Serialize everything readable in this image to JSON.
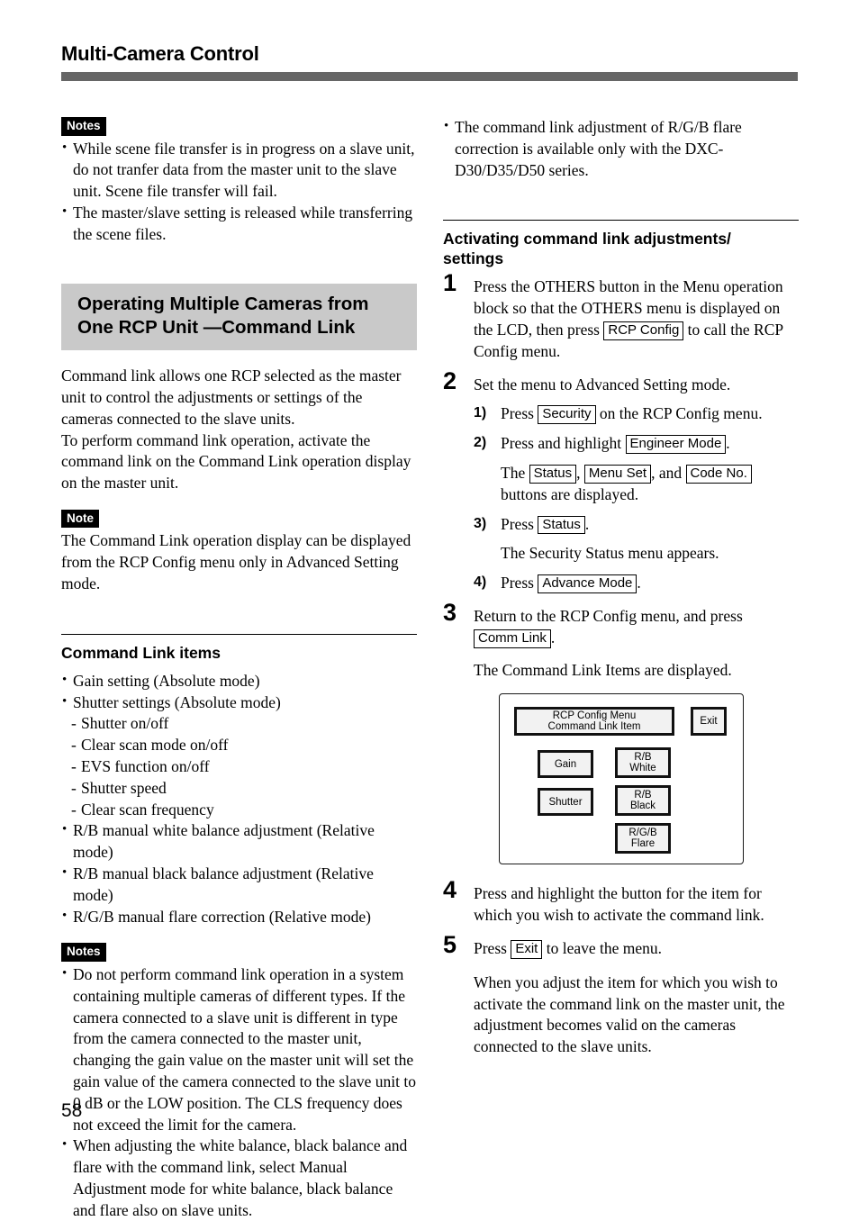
{
  "header": {
    "title": "Multi-Camera Control",
    "rule_color": "#666666"
  },
  "page_number": "58",
  "left_column": {
    "notes_top": {
      "badge": "Notes",
      "items": [
        "While scene file transfer is in progress on a slave unit, do not tranfer data from the master unit to the slave unit.  Scene file transfer will fail.",
        "The master/slave setting is released while transferring the scene files."
      ]
    },
    "section_heading": {
      "line1": "Operating Multiple Cameras from",
      "line2": "One RCP Unit —Command Link",
      "background": "#c9c9c9"
    },
    "intro_paragraph_1": "Command link allows one RCP selected as the master unit to control the adjustments or settings of the cameras connected to the slave units.",
    "intro_paragraph_2": "To perform command link operation, activate the command link on the Command Link operation display on the master unit.",
    "note_single": {
      "badge": "Note",
      "text": "The Command Link operation display can be displayed from the RCP Config menu only in Advanced Setting mode."
    },
    "command_link_items": {
      "heading": "Command Link items",
      "bullets": [
        "Gain setting (Absolute mode)",
        "Shutter settings (Absolute mode)"
      ],
      "sub_dashes": [
        "Shutter on/off",
        "Clear scan mode on/off",
        "EVS function on/off",
        "Shutter speed",
        "Clear scan frequency"
      ],
      "bullets_after": [
        "R/B manual white balance adjustment (Relative mode)",
        "R/B manual black balance adjustment (Relative mode)",
        "R/G/B manual flare correction (Relative mode)"
      ]
    },
    "notes_bottom": {
      "badge": "Notes",
      "items": [
        "Do not perform command link operation in a system containing multiple cameras of different types.  If the camera connected to a slave unit is different in type from the camera connected to the master unit, changing the gain value on the master unit will set the gain value of the camera connected to the slave unit to 0 dB or the LOW position.  The CLS frequency does not exceed the limit for the camera.",
        "When adjusting the white balance, black balance and flare with the command link, select Manual Adjustment mode for white balance, black balance and flare also on slave units."
      ]
    }
  },
  "right_column": {
    "top_bullet": "The command link adjustment of R/G/B flare correction is available only with the DXC-D30/D35/D50 series.",
    "section_heading": {
      "line1": "Activating command link adjustments/",
      "line2": "settings"
    },
    "steps": {
      "step1": {
        "number": "1",
        "text_before": "Press the OTHERS button in the Menu operation block so that the OTHERS menu is displayed on the LCD, then press",
        "key": "RCP Config",
        "text_after": "to call the RCP Config menu."
      },
      "step2": {
        "number": "2",
        "text": "Set the menu to Advanced Setting mode.",
        "sub1": {
          "number": "1)",
          "text_before": "Press",
          "key": "Security",
          "text_after": "on the RCP Config menu."
        },
        "sub2": {
          "number": "2)",
          "text_before": "Press and highlight",
          "key": "Engineer Mode",
          "text_after": "."
        },
        "sub2_note": {
          "lead": "The",
          "key1": "Status",
          "sep1": ",",
          "key2": "Menu Set",
          "sep2": ", and",
          "key3": "Code No.",
          "tail": "buttons are displayed."
        },
        "sub3": {
          "number": "3)",
          "text_before": "Press",
          "key": "Status",
          "text_after": "."
        },
        "sub3_note": "The Security Status menu appears.",
        "sub4": {
          "number": "4)",
          "text_before": "Press",
          "key": "Advance Mode",
          "text_after": "."
        }
      },
      "step3": {
        "number": "3",
        "text_before": "Return to  the RCP Config menu, and press",
        "key": "Comm Link",
        "text_after": ".",
        "result": "The Command Link Items are displayed."
      },
      "step4": {
        "number": "4",
        "text": "Press and highlight the button for the item for which you wish to activate the command link."
      },
      "step5": {
        "number": "5",
        "text_before": "Press",
        "key": "Exit",
        "text_after": "to leave the menu.",
        "result": "When you adjust the item for which you wish to activate the command link on the master unit, the adjustment becomes valid on the cameras connected to the slave units."
      }
    },
    "figure": {
      "title_button": "RCP Config Menu\nCommand Link Item",
      "exit_button": "Exit",
      "buttons_left": [
        "Gain",
        "Shutter"
      ],
      "buttons_right": [
        "R/B\nWhite",
        "R/B\nBlack",
        "R/G/B\nFlare"
      ]
    }
  }
}
